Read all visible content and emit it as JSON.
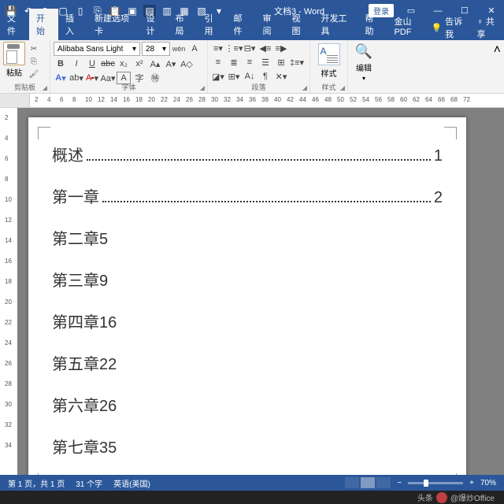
{
  "title": {
    "doc": "文档3",
    "app": "Word"
  },
  "login": "登录",
  "tabs": {
    "file": "文件",
    "home": "开始",
    "insert": "插入",
    "newtab": "新建选项卡",
    "design": "设计",
    "layout": "布局",
    "references": "引用",
    "mail": "邮件",
    "review": "审阅",
    "view": "视图",
    "dev": "开发工具",
    "help": "帮助",
    "wps": "金山PDF",
    "tell": "告诉我",
    "share": "共享"
  },
  "ribbon": {
    "clipboard": {
      "paste": "粘贴",
      "label": "剪贴板"
    },
    "font": {
      "name": "Alibaba Sans Light",
      "size": "28",
      "label": "字体"
    },
    "para": {
      "label": "段落"
    },
    "style": {
      "text": "样式",
      "label": "样式"
    },
    "edit": {
      "text": "编辑"
    }
  },
  "hruler": [
    2,
    4,
    6,
    8,
    10,
    12,
    14,
    16,
    18,
    20,
    22,
    24,
    26,
    28,
    30,
    32,
    34,
    36,
    38,
    40,
    42,
    44,
    46,
    48,
    50,
    52,
    54,
    56,
    58,
    60,
    62,
    64,
    66,
    68,
    72
  ],
  "vruler": [
    2,
    4,
    6,
    8,
    10,
    12,
    14,
    16,
    18,
    20,
    22,
    24,
    26,
    28,
    30,
    32,
    34
  ],
  "doc": {
    "lines": [
      {
        "title": "概述",
        "dots": true,
        "page": "1"
      },
      {
        "title": "第一章",
        "dots": true,
        "page": "2"
      },
      {
        "title": "第二章",
        "dots": false,
        "page": "5"
      },
      {
        "title": "第三章",
        "dots": false,
        "page": "9"
      },
      {
        "title": "第四章",
        "dots": false,
        "page": "16"
      },
      {
        "title": "第五章",
        "dots": false,
        "page": "22"
      },
      {
        "title": "第六章",
        "dots": false,
        "page": "26"
      },
      {
        "title": "第七章",
        "dots": false,
        "page": "35"
      }
    ]
  },
  "status": {
    "page": "第 1 页，共 1 页",
    "words": "31 个字",
    "lang": "英语(美国)",
    "zoom": "70%"
  },
  "watermark": {
    "prefix": "头条",
    "handle": "@爆炒Office"
  }
}
